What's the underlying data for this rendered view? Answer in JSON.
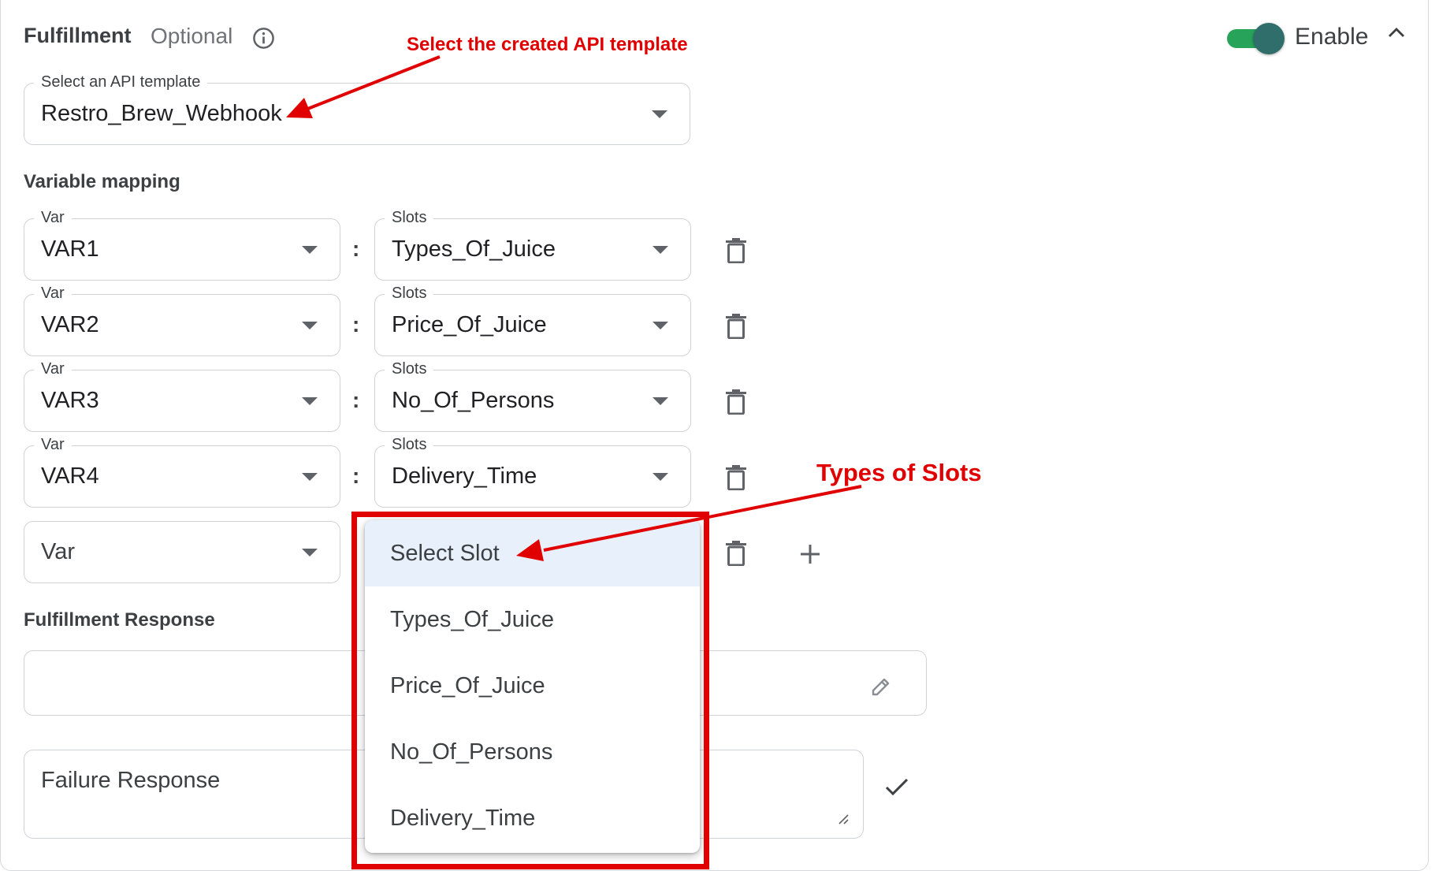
{
  "header": {
    "title": "Fulfillment",
    "optional": "Optional",
    "toggle_label": "Enable"
  },
  "api_template": {
    "label": "Select an API template",
    "value": "Restro_Brew_Webhook"
  },
  "variable_mapping": {
    "title": "Variable mapping",
    "rows": [
      {
        "var_label": "Var",
        "var_value": "VAR1",
        "slot_label": "Slots",
        "slot_value": "Types_Of_Juice"
      },
      {
        "var_label": "Var",
        "var_value": "VAR2",
        "slot_label": "Slots",
        "slot_value": "Price_Of_Juice"
      },
      {
        "var_label": "Var",
        "var_value": "VAR3",
        "slot_label": "Slots",
        "slot_value": "No_Of_Persons"
      },
      {
        "var_label": "Var",
        "var_value": "VAR4",
        "slot_label": "Slots",
        "slot_value": "Delivery_Time"
      }
    ],
    "new_row": {
      "var_placeholder": "Var"
    },
    "colon": ":"
  },
  "slot_dropdown": {
    "options": [
      "Select Slot",
      "Types_Of_Juice",
      "Price_Of_Juice",
      "No_Of_Persons",
      "Delivery_Time"
    ],
    "selected": "Select Slot"
  },
  "fulfillment_response": {
    "title": "Fulfillment Response",
    "failure_placeholder": "Failure Response"
  },
  "annotations": {
    "api_template_note": "Select the created API template",
    "slots_note": "Types of Slots",
    "color": "#e00000"
  },
  "colors": {
    "toggle_track": "#27a35a",
    "toggle_thumb": "#2f6e6a",
    "menu_highlight": "#e8f0fb"
  }
}
